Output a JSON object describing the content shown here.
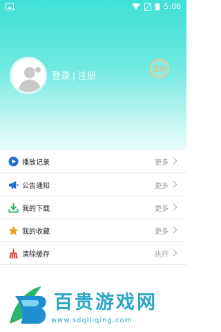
{
  "status_bar": {
    "time": "5:06"
  },
  "profile": {
    "login_label": "登录",
    "separator": "|",
    "register_label": "注册",
    "checkin_label": "签到"
  },
  "menu": [
    {
      "label": "播放记录",
      "action": "更多",
      "icon": "play-circle-icon",
      "color": "#1f6fd1"
    },
    {
      "label": "公告通知",
      "action": "更多",
      "icon": "megaphone-icon",
      "color": "#1f6fd1"
    },
    {
      "label": "我的下载",
      "action": "更多",
      "icon": "download-icon",
      "color": "#2ab36b"
    },
    {
      "label": "我的收藏",
      "action": "更多",
      "icon": "star-icon",
      "color": "#f39b1d"
    },
    {
      "label": "清除缓存",
      "action": "执行",
      "icon": "broom-icon",
      "color": "#e84a3c"
    }
  ],
  "watermark": {
    "brand": "百贵游戏网",
    "url": "www.sdqlliqing.com"
  },
  "colors": {
    "accent": "#3fe0d7",
    "text_muted": "#9b9b9b"
  }
}
